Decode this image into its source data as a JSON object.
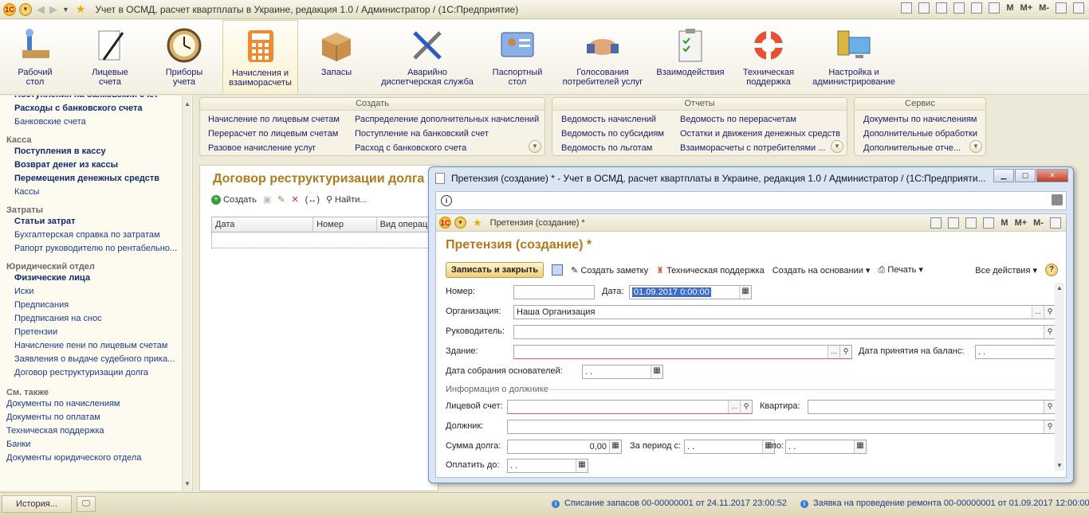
{
  "window": {
    "title": "Учет в ОСМД, расчет квартплаты в Украине, редакция 1.0 / Администратор /   (1С:Предприятие)",
    "memory_buttons": [
      "M",
      "M+",
      "M-"
    ]
  },
  "ribbon": {
    "items": [
      {
        "label1": "Рабочий",
        "label2": "стол",
        "icon": "desk-icon"
      },
      {
        "label1": "Лицевые",
        "label2": "счета",
        "icon": "pen-paper-icon"
      },
      {
        "label1": "Приборы",
        "label2": "учета",
        "icon": "meter-clock-icon"
      },
      {
        "label1": "Начисления и",
        "label2": "взаиморасчеты",
        "icon": "calculator-icon"
      },
      {
        "label1": "Запасы",
        "label2": "",
        "icon": "box-icon"
      },
      {
        "label1": "Аварийно",
        "label2": "диспетчерская служба",
        "icon": "tools-icon"
      },
      {
        "label1": "Паспортный",
        "label2": "стол",
        "icon": "id-card-icon"
      },
      {
        "label1": "Голосования",
        "label2": "потребителей услуг",
        "icon": "handshake-icon"
      },
      {
        "label1": "Взаимодействия",
        "label2": "",
        "icon": "clipboard-icon"
      },
      {
        "label1": "Техническая",
        "label2": "поддержка",
        "icon": "lifebuoy-icon"
      },
      {
        "label1": "Настройка и",
        "label2": "администрирование",
        "icon": "computer-icon"
      }
    ]
  },
  "leftnav": {
    "top_cut": "Поступления на банковский счет",
    "items_top": [
      {
        "text": "Расходы с банковского счета",
        "bold": true
      },
      {
        "text": "Банковские счета",
        "bold": false
      }
    ],
    "groups": [
      {
        "title": "Касса",
        "items": [
          {
            "text": "Поступления в кассу",
            "bold": true
          },
          {
            "text": "Возврат денег из кассы",
            "bold": true
          },
          {
            "text": "Перемещения денежных средств",
            "bold": true
          },
          {
            "text": "Кассы",
            "bold": false
          }
        ]
      },
      {
        "title": "Затраты",
        "items": [
          {
            "text": "Статьи затрат",
            "bold": true
          },
          {
            "text": "Бухгалтерская справка по затратам",
            "bold": false
          },
          {
            "text": "Рапорт руководителю по рентабельно...",
            "bold": false
          }
        ]
      },
      {
        "title": "Юридический отдел",
        "items": [
          {
            "text": "Физические лица",
            "bold": true
          },
          {
            "text": "Иски",
            "bold": false
          },
          {
            "text": "Предписания",
            "bold": false
          },
          {
            "text": "Предписания на снос",
            "bold": false
          },
          {
            "text": "Претензии",
            "bold": false
          },
          {
            "text": "Начисление пени по лицевым счетам",
            "bold": false
          },
          {
            "text": "Заявления о выдаче судебного прика...",
            "bold": false
          },
          {
            "text": "Договор реструктуризации долга",
            "bold": false
          }
        ]
      }
    ],
    "see_also_title": "См. также",
    "see_also": [
      "Документы по начислениям",
      "Документы по оплатам",
      "Техническая поддержка",
      "Банки",
      "Документы юридического отдела"
    ]
  },
  "panels": {
    "create": {
      "title": "Создать",
      "col1": [
        "Начисление по лицевым счетам",
        "Перерасчет по лицевым счетам",
        "Разовое начисление услуг"
      ],
      "col2": [
        "Распределение дополнительных начислений",
        "Поступление на банковский счет",
        "Расход с банковского счета"
      ]
    },
    "reports": {
      "title": "Отчеты",
      "col1": [
        "Ведомость начислений",
        "Ведомость по субсидиям",
        "Ведомость по льготам"
      ],
      "col2": [
        "Ведомость по перерасчетам",
        "Остатки и движения денежных средств",
        "Взаиморасчеты с потребителями ..."
      ]
    },
    "service": {
      "title": "Сервис",
      "col1": [
        "Документы по начислениям",
        "Дополнительные обработки",
        "Дополнительные отче..."
      ]
    }
  },
  "bgdoc": {
    "title": "Договор реструктуризации долга",
    "create_label": "Создать",
    "find_label": "Найти...",
    "columns": [
      "Дата",
      "Номер",
      "Вид операци"
    ]
  },
  "modal": {
    "title": "Претензия (создание) * - Учет в ОСМД, расчет квартплаты в Украине, редакция 1.0 / Администратор / (1С:Предприяти...",
    "inner_title": "Претензия (создание) *",
    "form_title": "Претензия (создание) *",
    "toolbar": {
      "save_close": "Записать и закрыть",
      "note": "Создать заметку",
      "support": "Техническая поддержка",
      "create_based": "Создать на основании",
      "print": "Печать",
      "all_actions": "Все действия"
    },
    "fields": {
      "number_label": "Номер:",
      "number_value": "",
      "date_label": "Дата:",
      "date_value": "01.09.2017  0:00:00",
      "org_label": "Организация:",
      "org_value": "Наша Организация",
      "head_label": "Руководитель:",
      "head_value": "",
      "building_label": "Здание:",
      "building_value": "",
      "balance_date_label": "Дата принятия на баланс:",
      "balance_date_value": " .  .",
      "founders_date_label": "Дата собрания основателей:",
      "founders_date_value": " .  .",
      "debtor_group": "Информация о должнике",
      "account_label": "Лицевой счет:",
      "account_value": "",
      "apartment_label": "Квартира:",
      "apartment_value": "",
      "debtor_label": "Должник:",
      "debtor_value": "",
      "debt_label": "Сумма долга:",
      "debt_value": "0,00",
      "period_from_label": "За период с:",
      "period_from_value": " .  .",
      "period_to_label": "по:",
      "period_to_value": " .  .",
      "pay_until_label": "Оплатить до:",
      "pay_until_value": " .  ."
    }
  },
  "statusbar": {
    "history": "История...",
    "msg1": "Списание запасов 00-00000001 от 24.11.2017 23:00:52",
    "msg2": "Заявка на проведение ремонта 00-00000001 от 01.09.2017 12:00:00"
  }
}
